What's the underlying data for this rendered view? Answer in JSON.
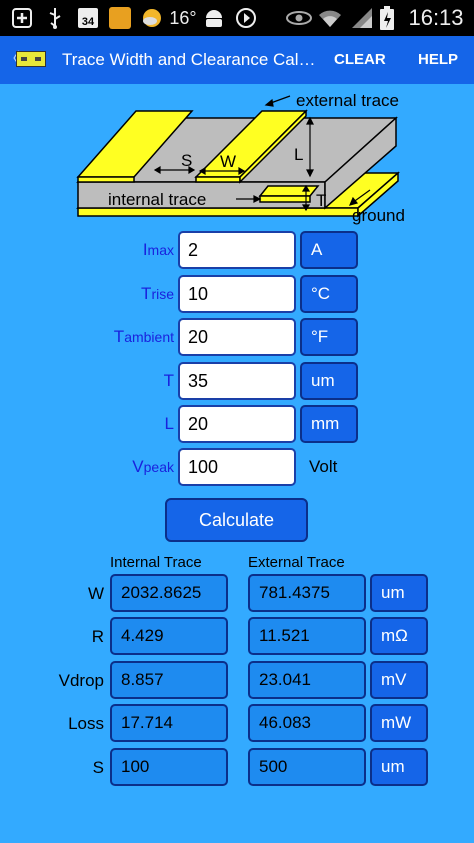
{
  "status_bar": {
    "time": "16:13",
    "temperature": "16°",
    "calendar_day": "34",
    "icons": [
      "plus-icon",
      "usb-icon",
      "calendar-icon",
      "notification-app-icon",
      "weather-icon",
      "android-icon",
      "play-icon",
      "eye-icon",
      "wifi-icon",
      "signal-icon",
      "battery-icon"
    ]
  },
  "action_bar": {
    "back_glyph": "〈",
    "title": "Trace Width and Clearance Cal…",
    "clear_label": "CLEAR",
    "help_label": "HELP"
  },
  "diagram": {
    "external_trace": "external trace",
    "internal_trace": "internal trace",
    "ground": "ground",
    "S": "S",
    "W": "W",
    "L": "L",
    "T": "T"
  },
  "inputs": [
    {
      "label_main": "I",
      "label_sub": "max",
      "value": "2",
      "unit": "A",
      "unit_button": true
    },
    {
      "label_main": "T",
      "label_sub": "rise",
      "value": "10",
      "unit": "°C",
      "unit_button": true
    },
    {
      "label_main": "T",
      "label_sub": "ambient",
      "value": "20",
      "unit": "°F",
      "unit_button": true
    },
    {
      "label_main": "T",
      "label_sub": "",
      "value": "35",
      "unit": "um",
      "unit_button": true
    },
    {
      "label_main": "L",
      "label_sub": "",
      "value": "20",
      "unit": "mm",
      "unit_button": true
    },
    {
      "label_main": "V",
      "label_sub": "peak",
      "value": "100",
      "unit": "Volt",
      "unit_button": false
    }
  ],
  "calculate_label": "Calculate",
  "results": {
    "internal_header": "Internal Trace",
    "external_header": "External Trace",
    "rows": [
      {
        "label": "W",
        "internal": "2032.8625",
        "external": "781.4375",
        "unit": "um"
      },
      {
        "label": "R",
        "internal": "4.429",
        "external": "11.521",
        "unit": "mΩ"
      },
      {
        "label": "Vdrop",
        "internal": "8.857",
        "external": "23.041",
        "unit": "mV"
      },
      {
        "label": "Loss",
        "internal": "17.714",
        "external": "46.083",
        "unit": "mW"
      },
      {
        "label": "S",
        "internal": "100",
        "external": "500",
        "unit": "um"
      }
    ]
  },
  "colors": {
    "background": "#33AAFF",
    "action_bar": "#1565E8",
    "label_blue": "#1A22DD",
    "trace_yellow": "#FFFF22"
  }
}
